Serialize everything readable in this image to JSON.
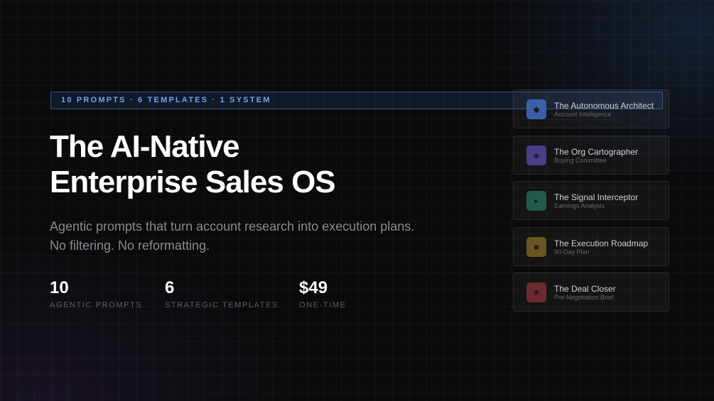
{
  "badge": "10 PROMPTS · 6 TEMPLATES · 1 SYSTEM",
  "title": {
    "line1": "The AI-Native",
    "line2": "Enterprise Sales OS"
  },
  "subtitle": {
    "line1": "Agentic prompts that turn account research into execution plans.",
    "line2": "No filtering. No reformatting."
  },
  "stats": [
    {
      "value": "10",
      "label": "AGENTIC PROMPTS"
    },
    {
      "value": "6",
      "label": "STRATEGIC TEMPLATES"
    },
    {
      "value": "$49",
      "label": "ONE-TIME"
    }
  ],
  "cards": [
    {
      "title": "The Autonomous Architect",
      "subtitle": "Account Intelligence",
      "icon": "diamond-icon",
      "glyph": "◆",
      "color": "#3b5fa8"
    },
    {
      "title": "The Org Cartographer",
      "subtitle": "Buying Committee",
      "icon": "diamond-outline-icon",
      "glyph": "◈",
      "color": "#4a3f86"
    },
    {
      "title": "The Signal Interceptor",
      "subtitle": "Earnings Analysis",
      "icon": "play-icon",
      "glyph": "▸",
      "color": "#1f5a4a"
    },
    {
      "title": "The Execution Roadmap",
      "subtitle": "90-Day Plan",
      "icon": "square-icon",
      "glyph": "■",
      "color": "#6b5520"
    },
    {
      "title": "The Deal Closer",
      "subtitle": "Pre-Negotiation Brief",
      "icon": "star-icon",
      "glyph": "★",
      "color": "#6a2a2e"
    }
  ]
}
